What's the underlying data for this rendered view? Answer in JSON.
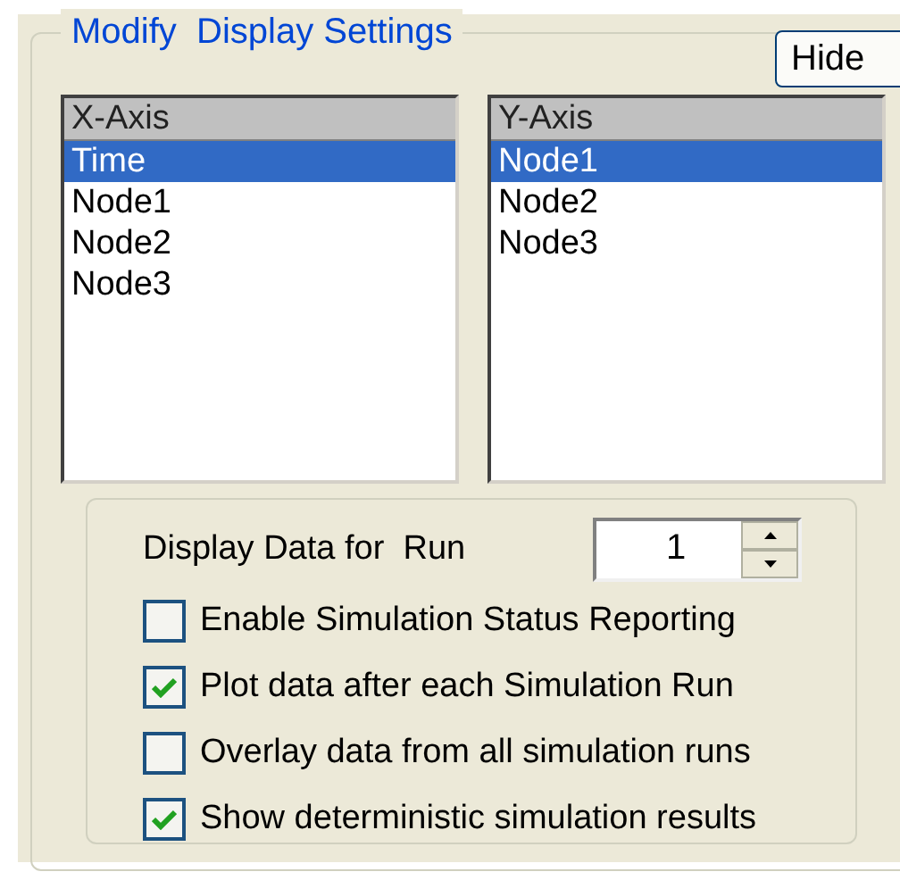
{
  "group": {
    "title": "Modify  Display Settings"
  },
  "hide_button": "Hide",
  "x_axis": {
    "header": "X-Axis",
    "items": [
      {
        "label": "Time",
        "selected": true
      },
      {
        "label": "Node1",
        "selected": false
      },
      {
        "label": "Node2",
        "selected": false
      },
      {
        "label": "Node3",
        "selected": false
      }
    ]
  },
  "y_axis": {
    "header": "Y-Axis",
    "items": [
      {
        "label": "Node1",
        "selected": true
      },
      {
        "label": "Node2",
        "selected": false
      },
      {
        "label": "Node3",
        "selected": false
      }
    ]
  },
  "run": {
    "label": "Display Data for  Run",
    "value": "1"
  },
  "options": [
    {
      "label": "Enable Simulation Status Reporting",
      "checked": false
    },
    {
      "label": "Plot data after each Simulation Run",
      "checked": true
    },
    {
      "label": "Overlay data from all simulation runs",
      "checked": false
    },
    {
      "label": "Show deterministic simulation results",
      "checked": true
    }
  ]
}
